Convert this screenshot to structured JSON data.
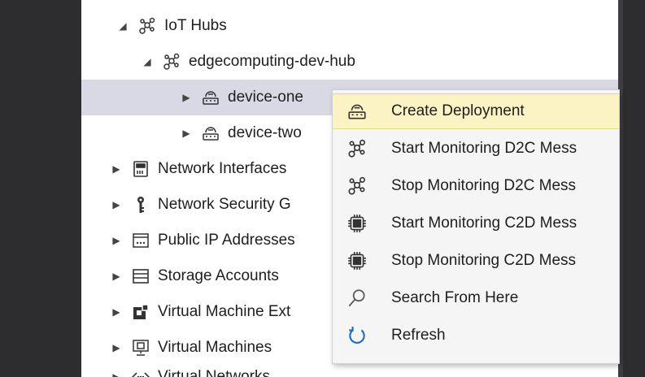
{
  "tree": {
    "items": [
      {
        "label": "IoT Hubs",
        "icon": "iot-hub-icon",
        "expanded": true
      },
      {
        "label": "edgecomputing-dev-hub",
        "icon": "iot-hub-icon",
        "expanded": true
      },
      {
        "label": "device-one",
        "icon": "device-icon",
        "expanded": false,
        "selected": true
      },
      {
        "label": "device-two",
        "icon": "device-icon",
        "expanded": false
      },
      {
        "label": "Network Interfaces",
        "icon": "network-interface-icon",
        "expanded": false
      },
      {
        "label": "Network Security G",
        "icon": "network-security-icon",
        "expanded": false
      },
      {
        "label": "Public IP Addresses",
        "icon": "public-ip-icon",
        "expanded": false
      },
      {
        "label": "Storage Accounts",
        "icon": "storage-icon",
        "expanded": false
      },
      {
        "label": "Virtual Machine Ext",
        "icon": "vm-extension-icon",
        "expanded": false
      },
      {
        "label": "Virtual Machines",
        "icon": "virtual-machine-icon",
        "expanded": false
      },
      {
        "label": "Virtual Networks",
        "icon": "virtual-network-icon",
        "expanded": false
      }
    ]
  },
  "context_menu": {
    "items": [
      {
        "label": "Create Deployment",
        "icon": "deployment-icon",
        "highlighted": true
      },
      {
        "label": "Start Monitoring D2C Mess",
        "icon": "iot-hub-icon"
      },
      {
        "label": "Stop Monitoring D2C Mess",
        "icon": "iot-hub-icon"
      },
      {
        "label": "Start Monitoring C2D Mess",
        "icon": "chip-icon"
      },
      {
        "label": "Stop Monitoring C2D Mess",
        "icon": "chip-icon"
      },
      {
        "label": "Search From Here",
        "icon": "search-icon"
      },
      {
        "label": "Refresh",
        "icon": "refresh-icon"
      }
    ]
  },
  "colors": {
    "panel_dark": "#2d2d30",
    "selection": "#d9d9e6",
    "menu_highlight": "#fbf3c3",
    "refresh_blue": "#1e6fbf"
  }
}
